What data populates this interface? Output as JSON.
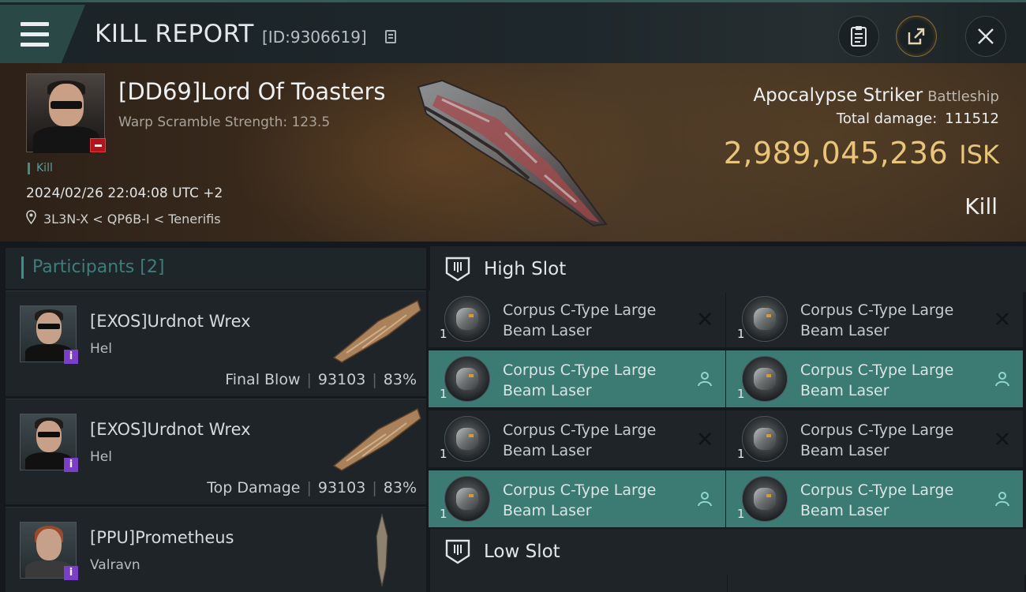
{
  "header": {
    "title": "KILL REPORT",
    "report_id": "[ID:9306619]"
  },
  "victim": {
    "name": "[DD69]Lord Of Toasters",
    "warp_scramble": "Warp Scramble Strength: 123.5",
    "kill_tag": "Kill",
    "datetime": "2024/02/26 22:04:08 UTC +2",
    "location": "3L3N-X < QP6B-I < Tenerifis",
    "ship_name": "Apocalypse Striker",
    "ship_class": "Battleship",
    "total_damage_label": "Total damage:",
    "total_damage": "111512",
    "isk_value": "2,989,045,236",
    "isk_unit": "ISK",
    "result": "Kill"
  },
  "participants": {
    "label": "Participants",
    "count": "[2]",
    "rows": [
      {
        "name": "[EXOS]Urdnot Wrex",
        "ship": "Hel",
        "role": "Final Blow",
        "damage": "93103",
        "percent": "83%"
      },
      {
        "name": "[EXOS]Urdnot Wrex",
        "ship": "Hel",
        "role": "Top Damage",
        "damage": "93103",
        "percent": "83%"
      },
      {
        "name": "[PPU]Prometheus",
        "ship": "Valravn"
      }
    ]
  },
  "slots": {
    "high_title": "High Slot",
    "low_title": "Low Slot",
    "modules": [
      {
        "name": "Corpus C-Type Large Beam Laser",
        "qty": "1",
        "status": "destroyed"
      },
      {
        "name": "Corpus C-Type Large Beam Laser",
        "qty": "1",
        "status": "destroyed"
      },
      {
        "name": "Corpus C-Type Large Beam Laser",
        "qty": "1",
        "status": "dropped"
      },
      {
        "name": "Corpus C-Type Large Beam Laser",
        "qty": "1",
        "status": "dropped"
      },
      {
        "name": "Corpus C-Type Large Beam Laser",
        "qty": "1",
        "status": "destroyed"
      },
      {
        "name": "Corpus C-Type Large Beam Laser",
        "qty": "1",
        "status": "destroyed"
      },
      {
        "name": "Corpus C-Type Large Beam Laser",
        "qty": "1",
        "status": "dropped"
      },
      {
        "name": "Corpus C-Type Large Beam Laser",
        "qty": "1",
        "status": "dropped"
      }
    ]
  },
  "icons": {
    "menu": "hamburger-icon",
    "copy": "copy-icon",
    "clipboard": "clipboard-icon",
    "share": "share-icon",
    "close": "close-icon",
    "location": "location-pin-icon",
    "destroyed": "x-icon",
    "dropped": "person-icon"
  },
  "colors": {
    "accent_teal": "#3c8f8a",
    "isk_gold": "#e9c57a",
    "info_purple": "#7b3ec8",
    "victim_badge_red": "#b3141c",
    "dropped_row": "#3c7a74"
  }
}
